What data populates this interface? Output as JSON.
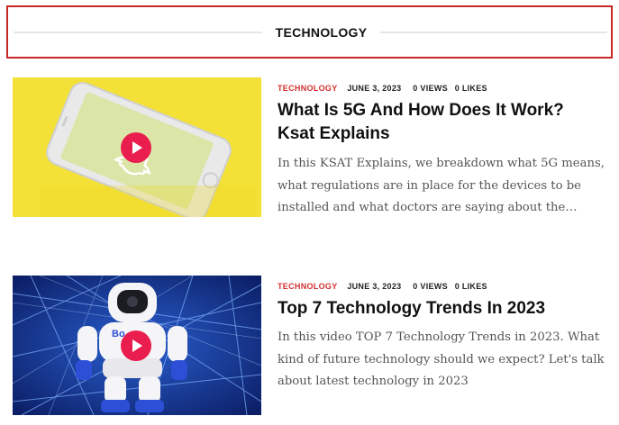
{
  "section": {
    "title": "TECHNOLOGY"
  },
  "posts": [
    {
      "category": "TECHNOLOGY",
      "date": "JUNE 3, 2023",
      "views": "0 VIEWS",
      "likes": "0 LIKES",
      "title": "What Is 5G And How Does It Work? Ksat Explains",
      "excerpt": "In this KSAT Explains, we breakdown what 5G means, what regulations are in place for the devices to be installed and what doctors are saying about the…",
      "thumbnail": "phone-on-yellow-image",
      "accent_color": "#d32f2f"
    },
    {
      "category": "TECHNOLOGY",
      "date": "JUNE 3, 2023",
      "views": "0 VIEWS",
      "likes": "0 LIKES",
      "title": "Top 7 Technology Trends In 2023",
      "excerpt": "In this video TOP 7 Technology Trends in 2023. What kind of future technology should we expect? Let's talk about latest technology in 2023",
      "thumbnail": "robot-on-blue-network-image",
      "robot_label": "Bo",
      "accent_color": "#d32f2f"
    }
  ],
  "colors": {
    "header_border": "#c62828",
    "play_button": "#e91e4e",
    "category": "#d32f2f"
  }
}
